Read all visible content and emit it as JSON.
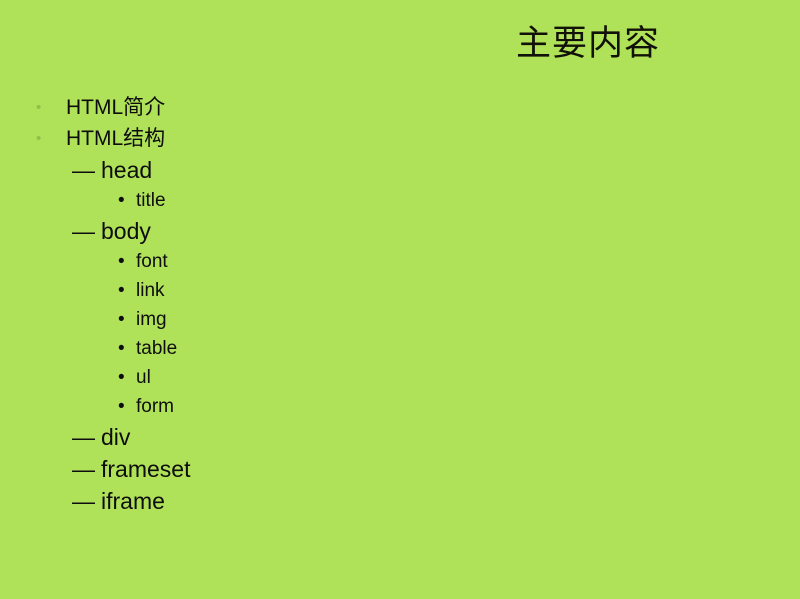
{
  "slide": {
    "background_color": "#b0e259",
    "title": "主要内容"
  },
  "bullets": {
    "level1_glyph": "•",
    "level2_glyph": "—",
    "level3_glyph": "•",
    "level1_color": "#8fc04a",
    "level3_color": "#0d0d0d",
    "text_color": "#0d0d0d"
  },
  "outline": [
    {
      "level": 1,
      "label": "HTML简介"
    },
    {
      "level": 1,
      "label": "HTML结构"
    },
    {
      "level": 2,
      "label": "head"
    },
    {
      "level": 3,
      "label": "title"
    },
    {
      "level": 2,
      "label": "body"
    },
    {
      "level": 3,
      "label": "font"
    },
    {
      "level": 3,
      "label": "link"
    },
    {
      "level": 3,
      "label": "img"
    },
    {
      "level": 3,
      "label": "table"
    },
    {
      "level": 3,
      "label": "ul"
    },
    {
      "level": 3,
      "label": "form"
    },
    {
      "level": 2,
      "label": "div"
    },
    {
      "level": 2,
      "label": "frameset"
    },
    {
      "level": 2,
      "label": "iframe"
    }
  ]
}
